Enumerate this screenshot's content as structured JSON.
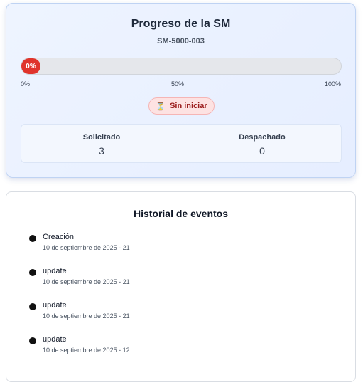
{
  "progress_card": {
    "title": "Progreso de la SM",
    "code": "SM-5000-003",
    "progress_percent": 0,
    "progress_label": "0%",
    "scale": {
      "min": "0%",
      "mid": "50%",
      "max": "100%"
    },
    "status": {
      "icon": "hourglass-icon",
      "label": "Sin iniciar"
    },
    "counts": {
      "requested_label": "Solicitado",
      "requested_value": "3",
      "dispatched_label": "Despachado",
      "dispatched_value": "0"
    },
    "colors": {
      "fill": "#e0342c",
      "badge_bg": "#fde2e2",
      "badge_text": "#9b1c1c"
    }
  },
  "history": {
    "title": "Historial de eventos",
    "events": [
      {
        "name": "Creación",
        "time": "10 de septiembre de 2025 - 21"
      },
      {
        "name": "update",
        "time": "10 de septiembre de 2025 - 21"
      },
      {
        "name": "update",
        "time": "10 de septiembre de 2025 - 21"
      },
      {
        "name": "update",
        "time": "10 de septiembre de 2025 - 12"
      }
    ]
  }
}
